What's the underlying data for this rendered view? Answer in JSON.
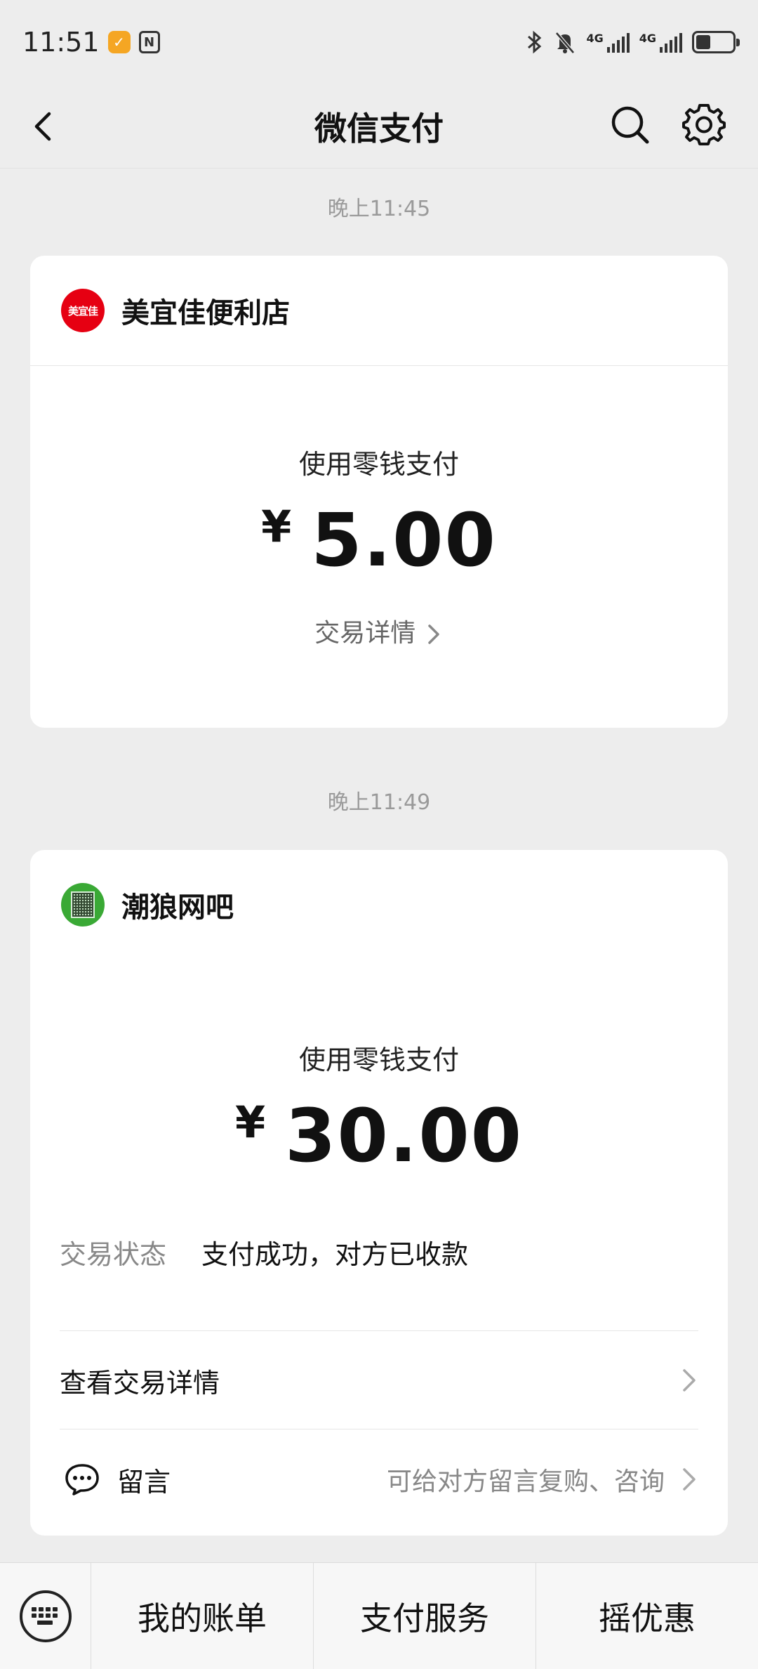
{
  "status_bar": {
    "time": "11:51",
    "app_badge_icon": "app-notification-icon",
    "nfc_label": "N",
    "network_1": "4G",
    "network_2": "4G",
    "battery_level": 0.4
  },
  "nav": {
    "title": "微信支付",
    "back_icon": "back-chevron-icon",
    "search_icon": "search-icon",
    "settings_icon": "gear-icon"
  },
  "messages": [
    {
      "timestamp": "晚上11:45",
      "merchant_name": "美宜佳便利店",
      "merchant_logo_text": "美宜佳",
      "pay_method": "使用零钱支付",
      "currency": "¥",
      "amount": "5.00",
      "detail_link": "交易详情"
    },
    {
      "timestamp": "晚上11:49",
      "merchant_name": "潮狼网吧",
      "pay_method": "使用零钱支付",
      "currency": "¥",
      "amount": "30.00",
      "status_label": "交易状态",
      "status_value": "支付成功，对方已收款",
      "view_detail": "查看交易详情",
      "message_label": "留言",
      "message_hint": "可给对方留言复购、咨询"
    }
  ],
  "bottom_bar": {
    "keyboard_icon": "keyboard-icon",
    "tabs": [
      "我的账单",
      "支付服务",
      "摇优惠"
    ]
  },
  "colors": {
    "background": "#ededed",
    "card": "#ffffff",
    "brand_red": "#e60012",
    "merchant_green": "#3aa935"
  }
}
